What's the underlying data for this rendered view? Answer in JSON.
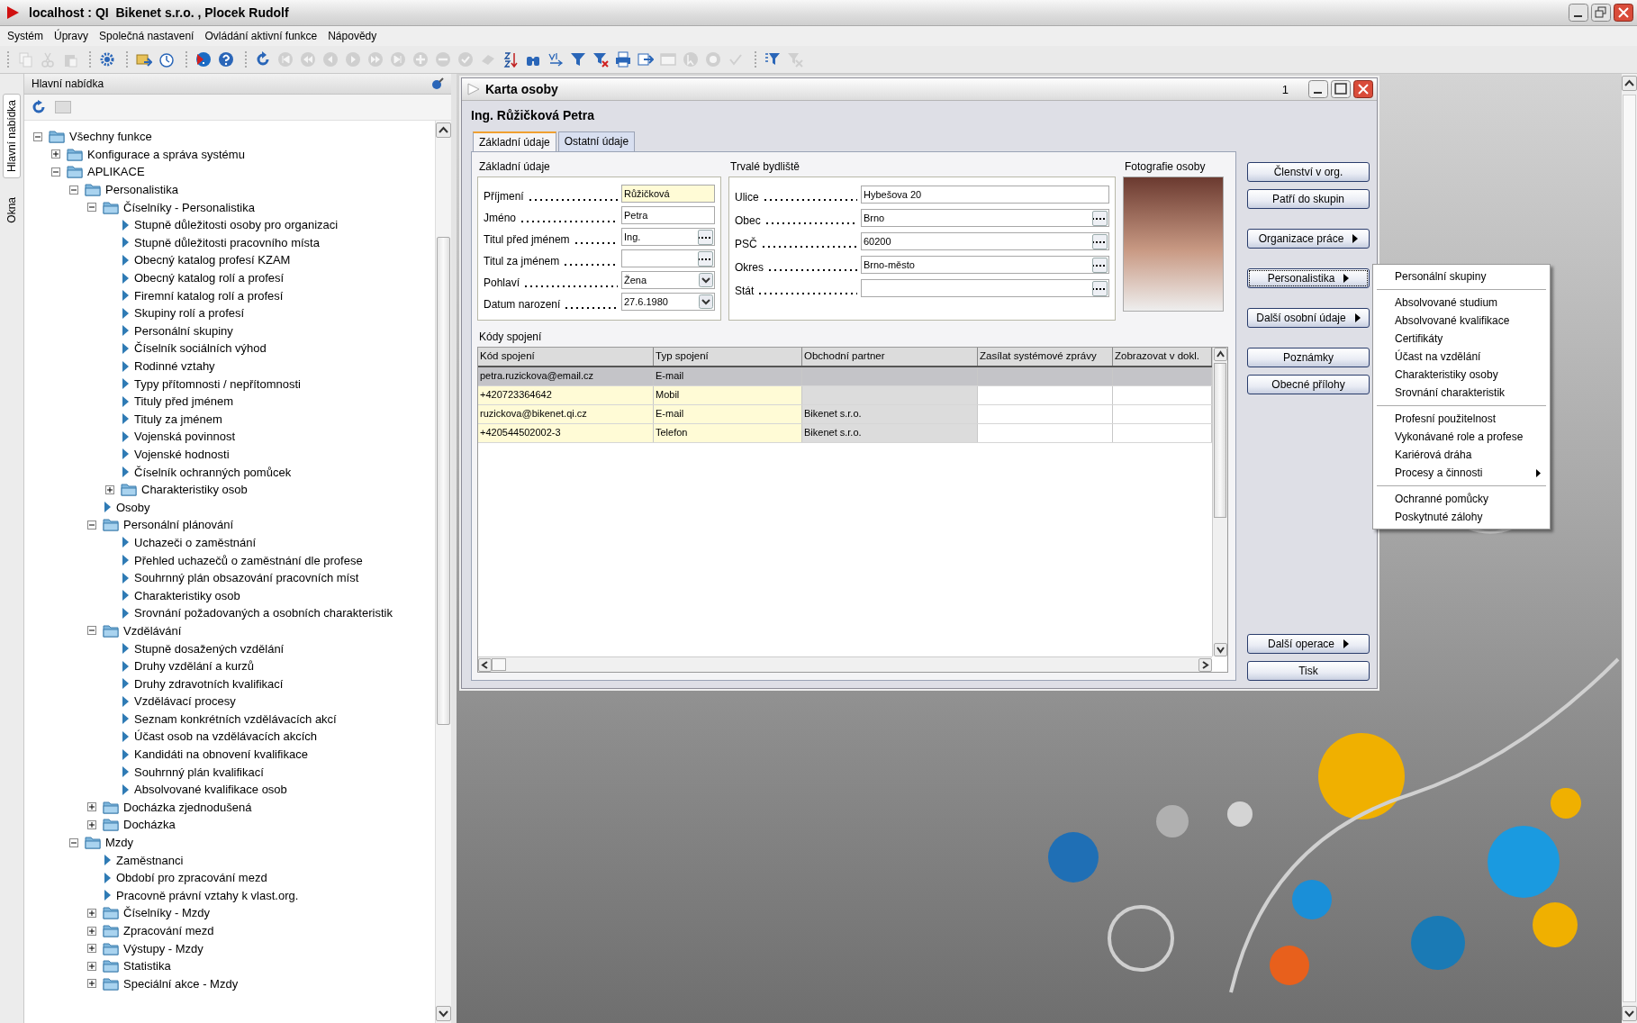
{
  "window": {
    "title": "localhost : QI  Bikenet s.r.o. , Plocek Rudolf"
  },
  "menu_bar": [
    "Systém",
    "Úpravy",
    "Společná nastavení",
    "Ovládání aktivní funkce",
    "Nápovědy"
  ],
  "toolbar": [
    [
      {
        "kind": "copy",
        "disabled": true
      },
      {
        "kind": "cut",
        "disabled": true
      },
      {
        "kind": "paste",
        "disabled": true
      }
    ],
    [
      {
        "kind": "gear",
        "disabled": false
      }
    ],
    [
      {
        "kind": "import",
        "disabled": false
      },
      {
        "kind": "timer",
        "disabled": false
      }
    ],
    [
      {
        "kind": "help-arrow",
        "disabled": false
      },
      {
        "kind": "help",
        "disabled": false
      }
    ],
    [
      {
        "kind": "refresh",
        "disabled": false
      },
      {
        "kind": "first",
        "disabled": true
      },
      {
        "kind": "rewind",
        "disabled": true
      },
      {
        "kind": "previous",
        "disabled": true
      },
      {
        "kind": "next",
        "disabled": true
      },
      {
        "kind": "forward",
        "disabled": true
      },
      {
        "kind": "last",
        "disabled": true
      },
      {
        "kind": "plus",
        "disabled": true
      },
      {
        "kind": "minus",
        "disabled": true
      },
      {
        "kind": "check",
        "disabled": true
      },
      {
        "kind": "eraser",
        "disabled": true
      },
      {
        "kind": "sort",
        "disabled": false
      },
      {
        "kind": "binoculars",
        "disabled": false
      },
      {
        "kind": "spellcheck",
        "disabled": false
      },
      {
        "kind": "filter",
        "disabled": false
      },
      {
        "kind": "filter-remove",
        "disabled": false
      },
      {
        "kind": "print",
        "disabled": false
      },
      {
        "kind": "export",
        "disabled": false
      },
      {
        "kind": "window",
        "disabled": true
      },
      {
        "kind": "pointer",
        "disabled": true
      },
      {
        "kind": "circle",
        "disabled": true
      },
      {
        "kind": "tick",
        "disabled": true
      }
    ],
    [
      {
        "kind": "filter-list",
        "disabled": false
      },
      {
        "kind": "filter-clear",
        "disabled": true
      }
    ]
  ],
  "side_tabs": [
    {
      "label": "Hlavní nabídka",
      "selected": true
    },
    {
      "label": "Okna",
      "selected": false
    }
  ],
  "sidebar": {
    "title": "Hlavní nabídka",
    "tree": [
      {
        "label": "Všechny funkce",
        "kind": "folder",
        "expanded": true,
        "children": [
          {
            "label": "Konfigurace a správa systému",
            "kind": "folder",
            "expanded": false
          },
          {
            "label": "APLIKACE",
            "kind": "folder",
            "expanded": true,
            "children": [
              {
                "label": "Personalistika",
                "kind": "folder",
                "expanded": true,
                "children": [
                  {
                    "label": "Číselníky - Personalistika",
                    "kind": "folder",
                    "expanded": true,
                    "children": [
                      {
                        "label": "Stupně důležitosti osoby pro organizaci",
                        "kind": "leaf"
                      },
                      {
                        "label": "Stupně důležitosti pracovního místa",
                        "kind": "leaf"
                      },
                      {
                        "label": "Obecný katalog profesí KZAM",
                        "kind": "leaf"
                      },
                      {
                        "label": "Obecný katalog rolí a profesí",
                        "kind": "leaf"
                      },
                      {
                        "label": "Firemní katalog rolí a profesí",
                        "kind": "leaf"
                      },
                      {
                        "label": "Skupiny rolí a profesí",
                        "kind": "leaf"
                      },
                      {
                        "label": "Personální skupiny",
                        "kind": "leaf"
                      },
                      {
                        "label": "Číselník sociálních výhod",
                        "kind": "leaf"
                      },
                      {
                        "label": "Rodinné vztahy",
                        "kind": "leaf"
                      },
                      {
                        "label": "Typy přítomnosti / nepřítomnosti",
                        "kind": "leaf"
                      },
                      {
                        "label": "Tituly před jménem",
                        "kind": "leaf"
                      },
                      {
                        "label": "Tituly za jménem",
                        "kind": "leaf"
                      },
                      {
                        "label": "Vojenská povinnost",
                        "kind": "leaf"
                      },
                      {
                        "label": "Vojenské hodnosti",
                        "kind": "leaf"
                      },
                      {
                        "label": "Číselník ochranných pomůcek",
                        "kind": "leaf"
                      },
                      {
                        "label": "Charakteristiky osob",
                        "kind": "folder",
                        "expanded": false
                      }
                    ]
                  },
                  {
                    "label": "Osoby",
                    "kind": "leaf"
                  },
                  {
                    "label": "Personální plánování",
                    "kind": "folder",
                    "expanded": true,
                    "children": [
                      {
                        "label": "Uchazeči o zaměstnání",
                        "kind": "leaf"
                      },
                      {
                        "label": "Přehled uchazečů o zaměstnání dle profese",
                        "kind": "leaf"
                      },
                      {
                        "label": "Souhrnný plán obsazování pracovních míst",
                        "kind": "leaf"
                      },
                      {
                        "label": "Charakteristiky osob",
                        "kind": "leaf"
                      },
                      {
                        "label": "Srovnání požadovaných a osobních charakteristik",
                        "kind": "leaf"
                      }
                    ]
                  },
                  {
                    "label": "Vzdělávání",
                    "kind": "folder",
                    "expanded": true,
                    "children": [
                      {
                        "label": "Stupně dosažených vzdělání",
                        "kind": "leaf"
                      },
                      {
                        "label": "Druhy vzdělání a kurzů",
                        "kind": "leaf"
                      },
                      {
                        "label": "Druhy zdravotních kvalifikací",
                        "kind": "leaf"
                      },
                      {
                        "label": "Vzdělávací procesy",
                        "kind": "leaf"
                      },
                      {
                        "label": "Seznam konkrétních vzdělávacích akcí",
                        "kind": "leaf"
                      },
                      {
                        "label": "Účast osob na vzdělávacích akcích",
                        "kind": "leaf"
                      },
                      {
                        "label": "Kandidáti na obnovení kvalifikace",
                        "kind": "leaf"
                      },
                      {
                        "label": "Souhrnný plán kvalifikací",
                        "kind": "leaf"
                      },
                      {
                        "label": "Absolvované kvalifikace osob",
                        "kind": "leaf"
                      }
                    ]
                  },
                  {
                    "label": "Docházka zjednodušená",
                    "kind": "folder",
                    "expanded": false
                  },
                  {
                    "label": "Docházka",
                    "kind": "folder",
                    "expanded": false
                  }
                ]
              },
              {
                "label": "Mzdy",
                "kind": "folder",
                "expanded": true,
                "children": [
                  {
                    "label": "Zaměstnanci",
                    "kind": "leaf"
                  },
                  {
                    "label": "Období pro zpracování mezd",
                    "kind": "leaf"
                  },
                  {
                    "label": "Pracovně právní vztahy k vlast.org.",
                    "kind": "leaf"
                  },
                  {
                    "label": "Číselníky - Mzdy",
                    "kind": "folder",
                    "expanded": false
                  },
                  {
                    "label": "Zpracování mezd",
                    "kind": "folder",
                    "expanded": false
                  },
                  {
                    "label": "Výstupy - Mzdy",
                    "kind": "folder",
                    "expanded": false
                  },
                  {
                    "label": "Statistika",
                    "kind": "folder",
                    "expanded": false
                  },
                  {
                    "label": "Speciální akce - Mzdy",
                    "kind": "folder",
                    "expanded": false
                  }
                ]
              }
            ]
          }
        ]
      }
    ]
  },
  "card": {
    "title": "Karta osoby",
    "number": "1",
    "person": "Ing. Růžičková Petra",
    "tabs": [
      {
        "label": "Základní údaje",
        "selected": true
      },
      {
        "label": "Ostatní údaje",
        "selected": false
      }
    ],
    "basic": {
      "title": "Základní údaje",
      "fields": [
        {
          "label": "Příjmení",
          "value": "Růžičková",
          "kind": "text",
          "required": true
        },
        {
          "label": "Jméno",
          "value": "Petra",
          "kind": "text",
          "required": false
        },
        {
          "label": "Titul před jménem",
          "value": "Ing.",
          "kind": "lookup",
          "required": false
        },
        {
          "label": "Titul za jménem",
          "kind": "lookup",
          "required": false
        },
        {
          "label": "Pohlaví",
          "value": "Žena",
          "kind": "dropdown",
          "required": false
        },
        {
          "label": "Datum narození",
          "value": "27.6.1980",
          "kind": "dropdown",
          "required": false
        }
      ]
    },
    "address": {
      "title": "Trvalé bydliště",
      "fields": [
        {
          "label": "Ulice",
          "value": "Hybešova 20",
          "kind": "text"
        },
        {
          "label": "Obec",
          "value": "Brno",
          "kind": "lookup"
        },
        {
          "label": "PSČ",
          "value": "60200",
          "kind": "lookup"
        },
        {
          "label": "Okres",
          "value": "Brno-město",
          "kind": "lookup"
        },
        {
          "label": "Stát",
          "kind": "lookup"
        }
      ]
    },
    "photo": {
      "title": "Fotografie osoby"
    },
    "contacts": {
      "title": "Kódy spojení",
      "columns": [
        {
          "label": "Kód spojení",
          "kind": "key"
        },
        {
          "label": "Typ spojení",
          "kind": "key"
        },
        {
          "label": "Obchodní partner",
          "kind": "readonly"
        },
        {
          "label": "Zasílat systémové zprávy",
          "kind": "plain"
        },
        {
          "label": "Zobrazovat v dokl.",
          "kind": "plain"
        }
      ],
      "rows": [
        {
          "selected": true,
          "cells": [
            "petra.ruzickova@email.cz",
            "E-mail",
            "",
            "",
            ""
          ]
        },
        {
          "selected": false,
          "cells": [
            "+420723364642",
            "Mobil",
            "",
            "",
            ""
          ]
        },
        {
          "selected": false,
          "cells": [
            "ruzickova@bikenet.qi.cz",
            "E-mail",
            "Bikenet s.r.o.",
            "",
            ""
          ]
        },
        {
          "selected": false,
          "cells": [
            "+420544502002-3",
            "Telefon",
            "Bikenet s.r.o.",
            "",
            ""
          ]
        }
      ]
    },
    "button_groups": [
      [
        {
          "label": "Členství v org.",
          "kind": "plain",
          "focused": false
        },
        {
          "label": "Patří do skupin",
          "kind": "plain",
          "focused": false
        }
      ],
      [
        {
          "label": "Organizace práce",
          "kind": "submenu",
          "focused": false
        }
      ],
      [
        {
          "label": "Personalistika",
          "kind": "submenu",
          "focused": true
        }
      ],
      [
        {
          "label": "Další osobní údaje",
          "kind": "submenu",
          "focused": false
        }
      ],
      [
        {
          "label": "Poznámky",
          "kind": "plain",
          "focused": false
        },
        {
          "label": "Obecné přílohy",
          "kind": "plain",
          "focused": false
        }
      ]
    ],
    "bottom_buttons": [
      {
        "label": "Další operace",
        "kind": "submenu",
        "focused": false
      },
      {
        "label": "Tisk",
        "kind": "plain",
        "focused": false
      }
    ]
  },
  "popup_menu": [
    [
      {
        "label": "Personální skupiny",
        "has_submenu": false
      }
    ],
    [
      {
        "label": "Absolvované studium",
        "has_submenu": false
      },
      {
        "label": "Absolvované kvalifikace",
        "has_submenu": false
      },
      {
        "label": "Certifikáty",
        "has_submenu": false
      },
      {
        "label": "Účast na vzdělání",
        "has_submenu": false
      },
      {
        "label": "Charakteristiky osoby",
        "has_submenu": false
      },
      {
        "label": "Srovnání charakteristik",
        "has_submenu": false
      }
    ],
    [
      {
        "label": "Profesní použitelnost",
        "has_submenu": false
      },
      {
        "label": "Vykonávané role a profese",
        "has_submenu": false
      },
      {
        "label": "Kariérová dráha",
        "has_submenu": false
      },
      {
        "label": "Procesy a činnosti",
        "has_submenu": true
      }
    ],
    [
      {
        "label": "Ochranné pomůcky",
        "has_submenu": false
      },
      {
        "label": "Poskytnuté zálohy",
        "has_submenu": false
      }
    ]
  ]
}
